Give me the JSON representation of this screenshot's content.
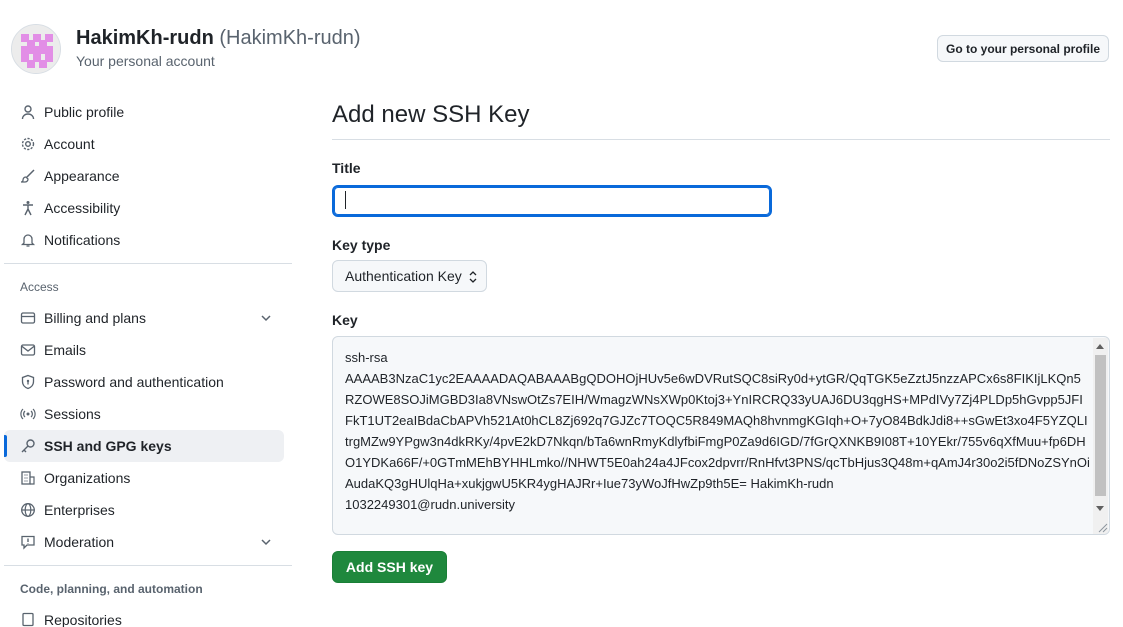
{
  "header": {
    "display_name": "HakimKh-rudn",
    "login": "(HakimKh-rudn)",
    "subtitle": "Your personal account",
    "profile_button": "Go to your personal profile"
  },
  "sidebar": {
    "items": [
      {
        "label": "Public profile",
        "icon": "person-icon"
      },
      {
        "label": "Account",
        "icon": "gear-icon"
      },
      {
        "label": "Appearance",
        "icon": "paintbrush-icon"
      },
      {
        "label": "Accessibility",
        "icon": "accessibility-icon"
      },
      {
        "label": "Notifications",
        "icon": "bell-icon"
      }
    ],
    "access_heading": "Access",
    "access_items": [
      {
        "label": "Billing and plans",
        "icon": "credit-card-icon",
        "expandable": true
      },
      {
        "label": "Emails",
        "icon": "mail-icon"
      },
      {
        "label": "Password and authentication",
        "icon": "shield-lock-icon"
      },
      {
        "label": "Sessions",
        "icon": "broadcast-icon"
      },
      {
        "label": "SSH and GPG keys",
        "icon": "key-icon",
        "active": true
      },
      {
        "label": "Organizations",
        "icon": "organization-icon"
      },
      {
        "label": "Enterprises",
        "icon": "globe-icon"
      },
      {
        "label": "Moderation",
        "icon": "report-icon",
        "expandable": true
      }
    ],
    "code_heading": "Code, planning, and automation",
    "code_items": [
      {
        "label": "Repositories",
        "icon": "repo-icon"
      }
    ]
  },
  "main": {
    "title": "Add new SSH Key",
    "title_label": "Title",
    "title_value": "",
    "key_type_label": "Key type",
    "key_type_value": "Authentication Key",
    "key_label": "Key",
    "key_value": "ssh-rsa\nAAAAB3NzaC1yc2EAAAADAQABAAABgQDOHOjHUv5e6wDVRutSQC8siRy0d+ytGR/QqTGK5eZztJ5nzzAPCx6s8FIKIjLKQn5RZOWE8SOJiMGBD3Ia8VNswOtZs7EIH/WmagzWNsXWp0Ktoj3+YnIRCRQ33yUAJ6DU3qgHS+MPdIVy7Zj4PLDp5hGvpp5JFIFkT1UT2eaIBdaCbAPVh521At0hCL8Zj692q7GJZc7TOQC5R849MAQh8hvnmgKGIqh+O+7yO84BdkJdi8++sGwEt3xo4F5YZQLItrgMZw9YPgw3n4dkRKy/4pvE2kD7Nkqn/bTa6wnRmyKdlyfbiFmgP0Za9d6IGD/7fGrQXNKB9I08T+10YEkr/755v6qXfMuu+fp6DHO1YDKa66F/+0GTmMEhBYHHLmko//NHWT5E0ah24a4JFcox2dpvrr/RnHfvt3PNS/qcTbHjus3Q48m+qAmJ4r30o2i5fDNoZSYnOiAudaKQ3gHUlqHa+xukjgwU5KR4ygHAJRr+Iue73yWoJfHwZp9th5E= HakimKh-rudn\n1032249301@rudn.university",
    "add_button": "Add SSH key"
  },
  "colors": {
    "accent": "#0969da",
    "primary_button": "#1f883d"
  }
}
